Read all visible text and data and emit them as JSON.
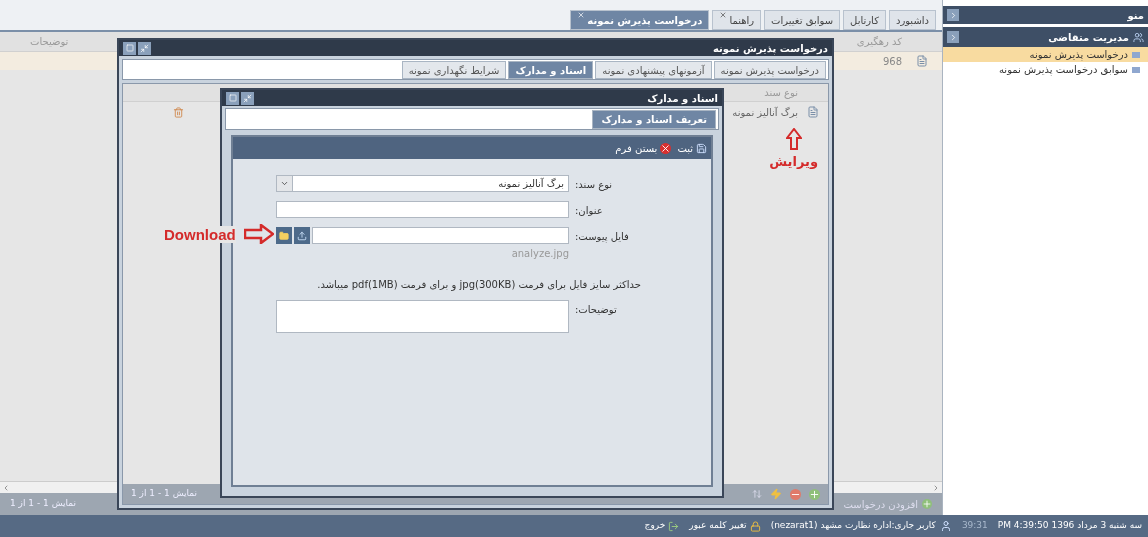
{
  "tabs": [
    {
      "label": "داشبورد",
      "selected": false,
      "closable": false
    },
    {
      "label": "کارتابل",
      "selected": false,
      "closable": false
    },
    {
      "label": "سوابق تغییرات",
      "selected": false,
      "closable": false
    },
    {
      "label": "راهنما",
      "selected": false,
      "closable": true
    },
    {
      "label": "درخواست پذیرش نمونه",
      "selected": true,
      "closable": true
    }
  ],
  "grid": {
    "columns": [
      "کد رهگیری",
      "توضیحات"
    ],
    "rows": [
      {
        "code": "968"
      }
    ],
    "paging": "نمایش 1 - 1 از 1",
    "add_button": "افزودن درخواست"
  },
  "request_window": {
    "title": "درخواست پذیرش نمونه",
    "tabs": [
      {
        "label": "درخواست پذیرش نمونه",
        "selected": false
      },
      {
        "label": "آزمونهای پیشنهادی نمونه",
        "selected": false
      },
      {
        "label": "اسناد و مدارک",
        "selected": true
      },
      {
        "label": "شرایط نگهداری نمونه",
        "selected": false
      }
    ],
    "grid": {
      "columns": [
        "نوع سند"
      ],
      "rows": [
        {
          "type": "برگ آنالیز نمونه"
        }
      ],
      "paging": "نمایش 1 - 1 از 1"
    }
  },
  "document_window": {
    "title": "اسناد و مدارک",
    "tabs": [
      {
        "label": "تعریف اسناد و مدارک",
        "selected": true
      }
    ],
    "toolbar": {
      "save": "ثبت",
      "close": "بستن فرم"
    },
    "form": {
      "doc_type_label": "نوع سند:",
      "doc_type_value": "برگ آنالیز نمونه",
      "title_label": "عنوان:",
      "file_label": "فایل پیوست:",
      "file_name": "analyze.jpg",
      "note": "حداکثر سایز فایل برای فرمت jpg(300KB) و برای فرمت pdf(1MB) میباشد.",
      "description_label": "توضیحات:"
    }
  },
  "sidebar": {
    "title": "منو",
    "group": "مدیریت متقاضی",
    "items": [
      {
        "label": "درخواست پذیرش نمونه",
        "selected": true
      },
      {
        "label": "سوابق درخواست پذیرش نمونه",
        "selected": false
      }
    ]
  },
  "annotations": {
    "download": "Download",
    "edit": "ویرایش"
  },
  "status_bar": {
    "datetime": "سه شنبه 3 مرداد 1396 PM 4:39:50",
    "timer": "39:31",
    "user": "کاربر جاری:اداره نظارت مشهد (nezarat1)",
    "change_password": "تغییر کلمه عبور",
    "exit": "خروج"
  }
}
